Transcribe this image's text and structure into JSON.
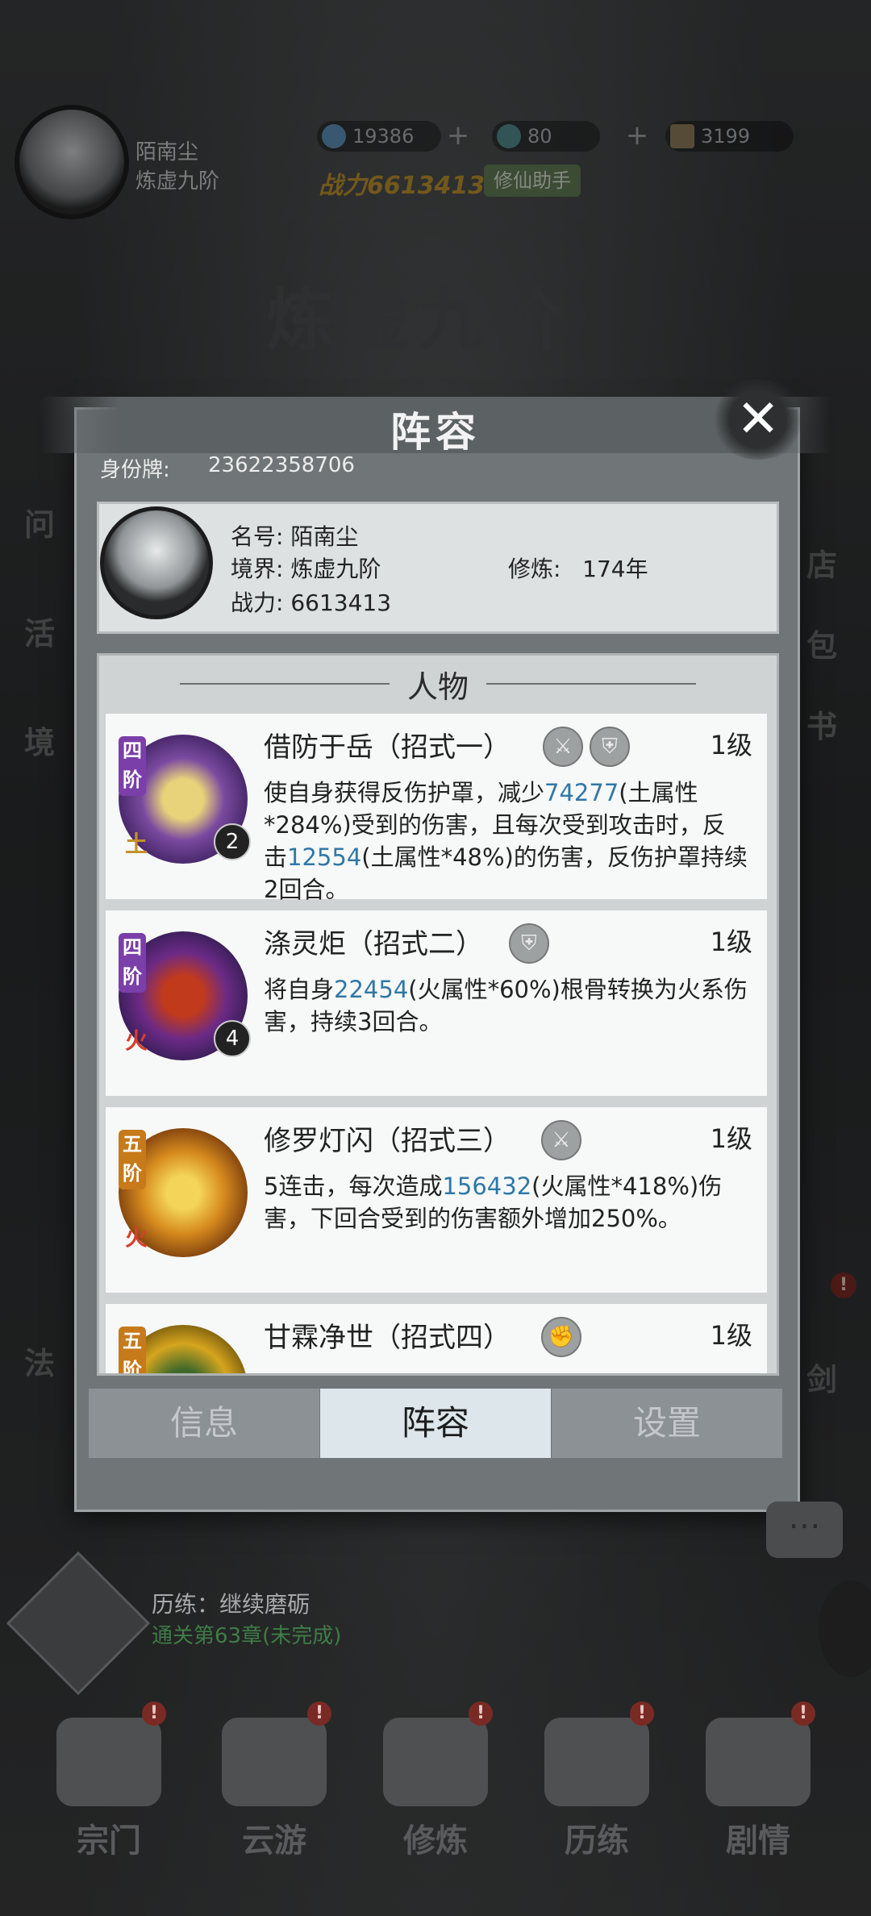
{
  "hud": {
    "player_name": "陌南尘",
    "player_realm": "炼虚九阶",
    "resources": [
      {
        "name": "spirit-stone",
        "value": "19386",
        "color": "#5a8fb5"
      },
      {
        "name": "jade",
        "value": "80",
        "color": "#4f8a8a"
      },
      {
        "name": "scroll",
        "value": "3199",
        "color": "#8a7a5a"
      }
    ],
    "power_label": "战力",
    "power_value": "6613413",
    "assistant_label": "修仙助手",
    "realm_banner": "炼虚九阶"
  },
  "dialog": {
    "title": "阵容",
    "close_icon": "close-icon",
    "id_label": "身份牌:",
    "id_value": "23622358706",
    "profile": {
      "name_label": "名号:",
      "name_value": "陌南尘",
      "realm_label": "境界:",
      "realm_value": "炼虚九阶",
      "cultivate_label": "修炼:",
      "cultivate_value": "174年",
      "power_label": "战力:",
      "power_value": "6613413"
    },
    "section_title": "人物",
    "skills": [
      {
        "name": "借防于岳（招式一）",
        "level": "1级",
        "tier": "四阶",
        "element": "土",
        "badge": "2",
        "desc_parts": [
          "使自身获得反伤护罩，减少",
          "74277",
          "(土属性*284%)受到的伤害，且每次受到攻击时，反击",
          "12554",
          "(土属性*48%)的伤害，反伤护罩持续2回合。"
        ]
      },
      {
        "name": "涤灵炬（招式二）",
        "level": "1级",
        "tier": "四阶",
        "element": "火",
        "badge": "4",
        "desc_parts": [
          "将自身",
          "22454",
          "(火属性*60%)根骨转换为火系伤害，持续3回合。"
        ]
      },
      {
        "name": "修罗灯闪（招式三）",
        "level": "1级",
        "tier": "五阶",
        "element": "火",
        "desc_parts": [
          "5连击，每次造成",
          "156432",
          "(火属性*418%)伤害，下回合受到的伤害额外增加250%。"
        ]
      },
      {
        "name": "甘霖净世（招式四）",
        "level": "1级",
        "tier": "五阶"
      }
    ],
    "tabs": [
      "信息",
      "阵容",
      "设置"
    ],
    "active_tab": "阵容"
  },
  "quest": {
    "line1": "历练：继续磨砺",
    "line2": "通关第63章(未完成)"
  },
  "bottom_nav": [
    "宗门",
    "云游",
    "修炼",
    "历练",
    "剧情"
  ],
  "side_left": [
    "问",
    "活",
    "境",
    "法"
  ],
  "side_right": [
    "店",
    "包",
    "书",
    "剑"
  ],
  "colors": {
    "highlight": "#2f78a7",
    "power": "#b88f2c",
    "tab_active": "#dde6ea"
  }
}
